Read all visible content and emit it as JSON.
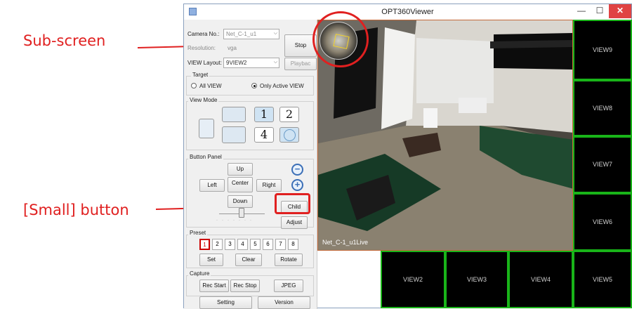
{
  "annotations": {
    "subscreen_label": "Sub-screen",
    "small_button_label": "[Small]  button"
  },
  "window": {
    "title": "OPT360Viewer",
    "minimize": "—",
    "maximize": "☐",
    "close": "✕"
  },
  "panel": {
    "camera_no_label": "Camera No.:",
    "camera_no_value": "Net_C-1_u1",
    "stop_label": "Stop",
    "resolution_label": "Resolution:",
    "resolution_value": "vga",
    "view_layout_label": "VIEW Layout:",
    "view_layout_value": "9VIEW2",
    "playback_label": "Playbac",
    "target": {
      "title": "Target",
      "all_view": "All VIEW",
      "only_active": "Only Active VIEW",
      "selected": "only_active"
    },
    "view_mode": {
      "title": "View Mode",
      "num1": "1",
      "num2": "2",
      "num4": "4"
    },
    "button_panel": {
      "title": "Button Panel",
      "up": "Up",
      "left": "Left",
      "center": "Center",
      "right": "Right",
      "down": "Down",
      "child": "Child",
      "adjust": "Adjust",
      "zoom_out": "−",
      "zoom_in": "+"
    },
    "preset": {
      "title": "Preset",
      "numbers": [
        "1",
        "2",
        "3",
        "4",
        "5",
        "6",
        "7",
        "8"
      ],
      "selected": "1",
      "set": "Set",
      "clear": "Clear",
      "rotate": "Rotate"
    },
    "capture": {
      "title": "Capture",
      "rec_start": "Rec Start",
      "rec_stop": "Rec Stop",
      "jpeg": "JPEG"
    },
    "setting": "Setting",
    "version": "Version"
  },
  "camera_view": {
    "caption": "Net_C-1_u1Live"
  },
  "views": {
    "view9": "VIEW9",
    "view8": "VIEW8",
    "view7": "VIEW7",
    "view6": "VIEW6",
    "view5": "VIEW5",
    "view4": "VIEW4",
    "view3": "VIEW3",
    "view2": "VIEW2"
  },
  "colors": {
    "annotation_red": "#e02020",
    "view_border_green": "#19b419",
    "preset_selected": "#cc0000"
  }
}
